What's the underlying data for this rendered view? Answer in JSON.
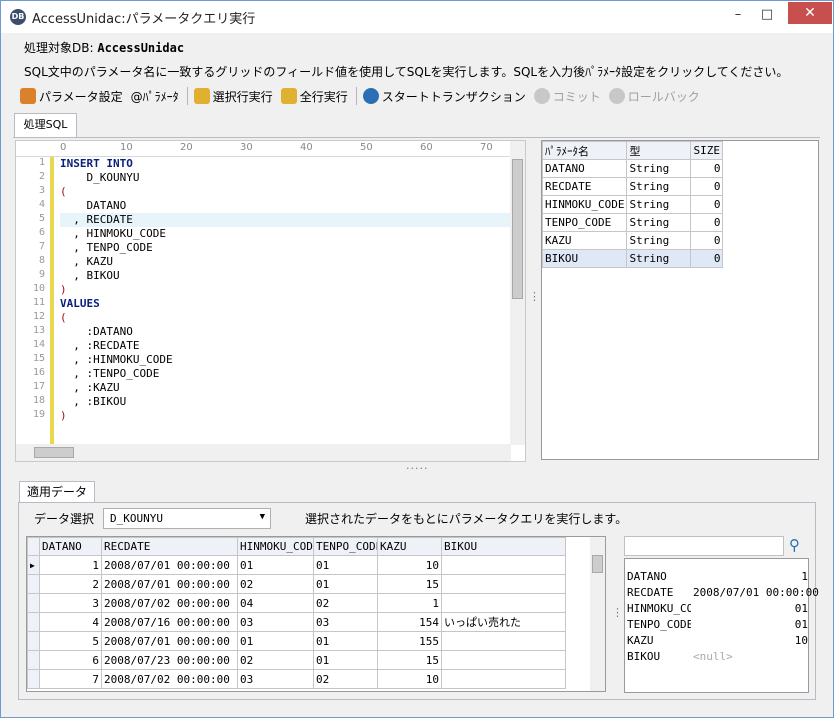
{
  "window": {
    "title": "AccessUnidac:パラメータクエリ実行",
    "icon": "app-logo-icon",
    "minimize": "–",
    "maximize": "□",
    "close": "✕"
  },
  "target": {
    "label": "処理対象DB:",
    "value": "AccessUnidac"
  },
  "description": "SQL文中のパラメータ名に一致するグリッドのフィールド値を使用してSQLを実行します。SQLを入力後ﾊﾟﾗﾒｰﾀ設定をクリックしてください。",
  "toolbar": {
    "param_setting": "パラメータ設定",
    "at_param": "@ﾊﾟﾗﾒｰﾀ",
    "run_selected": "選択行実行",
    "run_all": "全行実行",
    "start_tx": "スタートトランザクション",
    "commit": "コミット",
    "rollback": "ロールバック"
  },
  "sql_tab": "処理SQL",
  "ruler": [
    "0",
    "10",
    "20",
    "30",
    "40",
    "50",
    "60",
    "70"
  ],
  "sql_lines": [
    "INSERT INTO",
    "    D_KOUNYU",
    "(",
    "    DATANO",
    "  , RECDATE",
    "  , HINMOKU_CODE",
    "  , TENPO_CODE",
    "  , KAZU",
    "  , BIKOU",
    ")",
    "VALUES",
    "(",
    "    :DATANO",
    "  , :RECDATE",
    "  , :HINMOKU_CODE",
    "  , :TENPO_CODE",
    "  , :KAZU",
    "  , :BIKOU",
    ")"
  ],
  "params": {
    "headers": [
      "ﾊﾟﾗﾒｰﾀ名",
      "型",
      "SIZE"
    ],
    "rows": [
      [
        "DATANO",
        "String",
        "0"
      ],
      [
        "RECDATE",
        "String",
        "0"
      ],
      [
        "HINMOKU_CODE",
        "String",
        "0"
      ],
      [
        "TENPO_CODE",
        "String",
        "0"
      ],
      [
        "KAZU",
        "String",
        "0"
      ],
      [
        "BIKOU",
        "String",
        "0"
      ]
    ]
  },
  "data_tab": "適用データ",
  "data_select": {
    "label": "データ選択",
    "value": "D_KOUNYU",
    "info": "選択されたデータをもとにパラメータクエリを実行します。"
  },
  "grid": {
    "headers": [
      "DATANO",
      "RECDATE",
      "HINMOKU_CODE",
      "TENPO_CODE",
      "KAZU",
      "BIKOU"
    ],
    "rows": [
      [
        "1",
        "2008/07/01 00:00:00",
        "01",
        "01",
        "10",
        ""
      ],
      [
        "2",
        "2008/07/01 00:00:00",
        "02",
        "01",
        "15",
        ""
      ],
      [
        "3",
        "2008/07/02 00:00:00",
        "04",
        "02",
        "1",
        ""
      ],
      [
        "4",
        "2008/07/16 00:00:00",
        "03",
        "03",
        "154",
        "いっぱい売れた"
      ],
      [
        "5",
        "2008/07/01 00:00:00",
        "01",
        "01",
        "155",
        ""
      ],
      [
        "6",
        "2008/07/23 00:00:00",
        "02",
        "01",
        "15",
        ""
      ],
      [
        "7",
        "2008/07/02 00:00:00",
        "03",
        "02",
        "10",
        ""
      ]
    ]
  },
  "detail": [
    [
      "DATANO",
      "1"
    ],
    [
      "RECDATE",
      "2008/07/01 00:00:00"
    ],
    [
      "HINMOKU_CODE",
      "01"
    ],
    [
      "TENPO_CODE",
      "01"
    ],
    [
      "KAZU",
      "10"
    ],
    [
      "BIKOU",
      "<null>"
    ]
  ],
  "colors": {
    "accent": "#2a6fb5",
    "keyword": "#0a1f7a",
    "bracket": "#a41010",
    "close": "#c7504f"
  }
}
